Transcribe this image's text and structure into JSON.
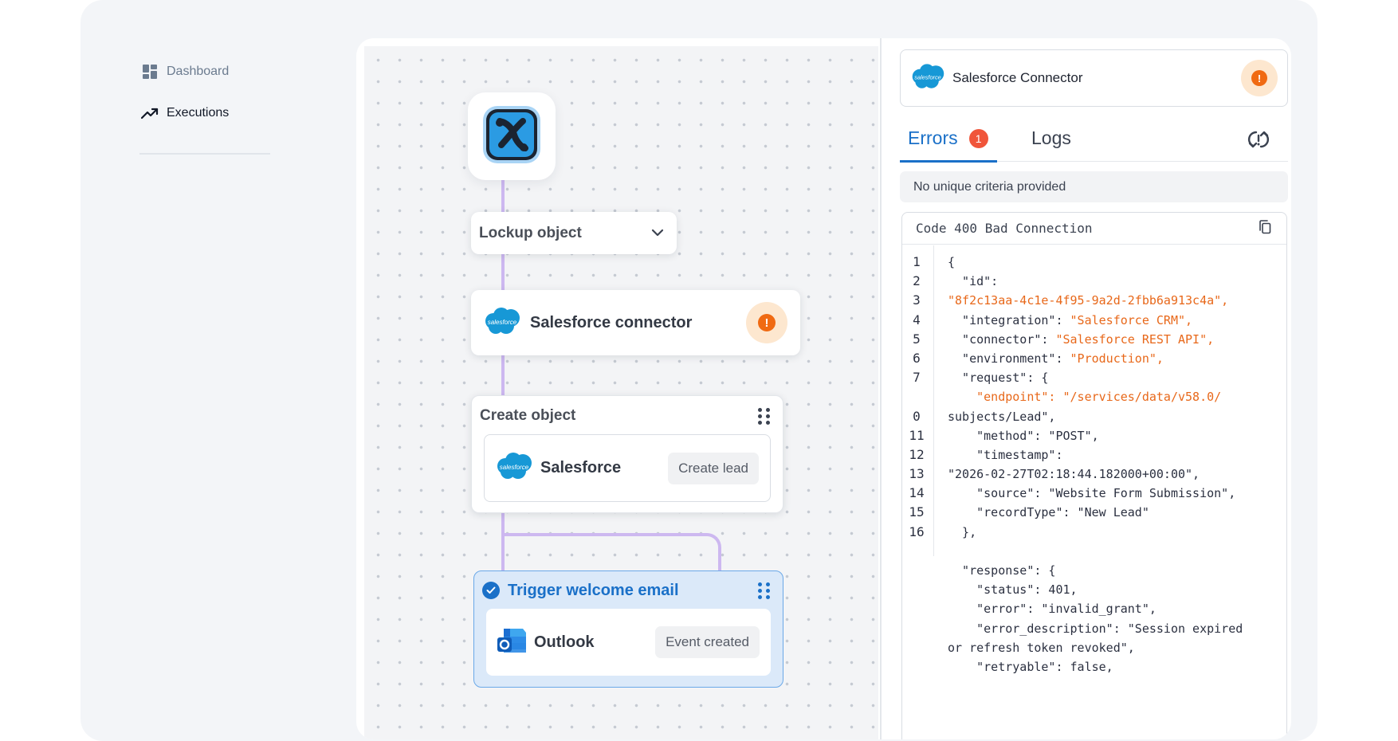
{
  "sidebar": {
    "items": [
      {
        "label": "Dashboard",
        "icon": "dashboard-icon"
      },
      {
        "label": "Executions",
        "icon": "trending-up-icon"
      }
    ]
  },
  "canvas": {
    "lockup_node": {
      "title": "Lockup object"
    },
    "salesforce_node": {
      "title": "Salesforce connector",
      "status": "!"
    },
    "create_node": {
      "title": "Create object",
      "service": "Salesforce",
      "action": "Create lead"
    },
    "trigger_node": {
      "title": "Trigger welcome email",
      "service": "Outlook",
      "action": "Event created"
    },
    "salesforce_logo_text": "salesforce"
  },
  "panel": {
    "connector_title": "Salesforce Connector",
    "warning": "!",
    "tabs": {
      "errors": "Errors",
      "errors_count": "1",
      "logs": "Logs"
    },
    "criteria": "No unique criteria provided",
    "code_title": "Code 400 Bad Connection",
    "code_lines": [
      {
        "num": "1",
        "parts": [
          [
            "k",
            "{"
          ]
        ]
      },
      {
        "num": "2",
        "parts": [
          [
            "k",
            "  \"id\":"
          ]
        ]
      },
      {
        "num": "3",
        "parts": [
          [
            "s",
            "\"8f2c13aa-4c1e-4f95-9a2d-2fbb6a913c4a\","
          ]
        ]
      },
      {
        "num": "4",
        "parts": [
          [
            "k",
            "  \"integration\": "
          ],
          [
            "s",
            "\"Salesforce CRM\","
          ]
        ]
      },
      {
        "num": "5",
        "parts": [
          [
            "k",
            "  \"connector\": "
          ],
          [
            "s",
            "\"Salesforce REST API\","
          ]
        ]
      },
      {
        "num": "6",
        "parts": [
          [
            "k",
            "  \"environment\": "
          ],
          [
            "s",
            "\"Production\","
          ]
        ]
      },
      {
        "num": "7",
        "parts": [
          [
            "k",
            "  \"request\": {"
          ]
        ]
      },
      {
        "num": "",
        "parts": [
          [
            "s",
            "    \"endpoint\": \"/services/data/v58.0/"
          ]
        ]
      },
      {
        "num": "0",
        "parts": [
          [
            "k",
            "subjects/Lead\","
          ]
        ]
      },
      {
        "num": "11",
        "parts": [
          [
            "k",
            "    \"method\": \"POST\","
          ]
        ]
      },
      {
        "num": "12",
        "parts": [
          [
            "k",
            "    \"timestamp\":"
          ]
        ]
      },
      {
        "num": "13",
        "parts": [
          [
            "k",
            "\"2026-02-27T02:18:44.182000+00:00\","
          ]
        ]
      },
      {
        "num": "14",
        "parts": [
          [
            "k",
            "    \"source\": \"Website Form Submission\","
          ]
        ]
      },
      {
        "num": "15",
        "parts": [
          [
            "k",
            "    \"recordType\": \"New Lead\""
          ]
        ]
      },
      {
        "num": "16",
        "parts": [
          [
            "k",
            "  },"
          ]
        ]
      },
      {
        "num": "",
        "parts": [
          [
            "k",
            ""
          ]
        ]
      },
      {
        "num": "",
        "parts": [
          [
            "k",
            "  \"response\": {"
          ]
        ]
      },
      {
        "num": "",
        "parts": [
          [
            "k",
            "    \"status\": 401,"
          ]
        ]
      },
      {
        "num": "",
        "parts": [
          [
            "k",
            "    \"error\": \"invalid_grant\","
          ]
        ]
      },
      {
        "num": "",
        "parts": [
          [
            "k",
            "    \"error_description\": \"Session expired"
          ]
        ]
      },
      {
        "num": "",
        "parts": [
          [
            "k",
            "or refresh token revoked\","
          ]
        ]
      },
      {
        "num": "",
        "parts": [
          [
            "k",
            "    \"retryable\": false,"
          ]
        ]
      }
    ]
  },
  "colors": {
    "accent": "#1a70c8",
    "warning": "#f06a12",
    "error_badge": "#f0553a",
    "string": "#e8681a",
    "connector_line": "#cdb8f0"
  }
}
